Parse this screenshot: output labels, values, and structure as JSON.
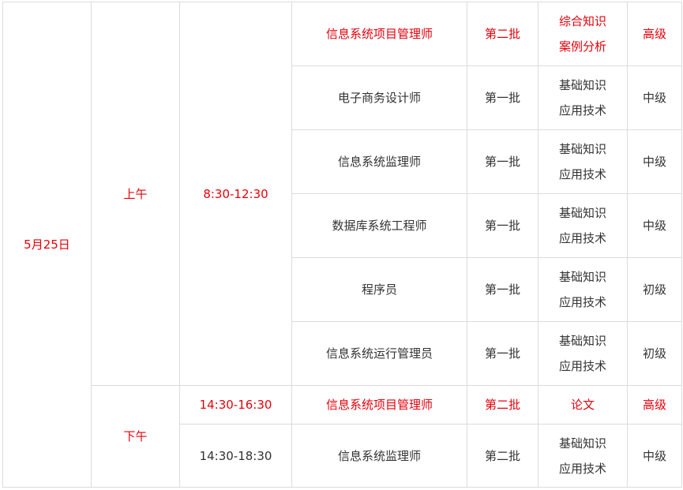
{
  "colors": {
    "highlight": "#e8000b",
    "text": "#333333",
    "border": "#dcdcdc"
  },
  "schedule": {
    "date": "5月25日",
    "morning": {
      "label": "上午",
      "time": "8:30-12:30"
    },
    "afternoon": {
      "label": "下午"
    },
    "rows": [
      {
        "time": "",
        "exam": "信息系统项目管理师",
        "batch": "第二批",
        "subjects": [
          "综合知识",
          "案例分析"
        ],
        "level": "高级",
        "highlight": true
      },
      {
        "time": "",
        "exam": "电子商务设计师",
        "batch": "第一批",
        "subjects": [
          "基础知识",
          "应用技术"
        ],
        "level": "中级",
        "highlight": false
      },
      {
        "time": "",
        "exam": "信息系统监理师",
        "batch": "第一批",
        "subjects": [
          "基础知识",
          "应用技术"
        ],
        "level": "中级",
        "highlight": false
      },
      {
        "time": "",
        "exam": "数据库系统工程师",
        "batch": "第一批",
        "subjects": [
          "基础知识",
          "应用技术"
        ],
        "level": "中级",
        "highlight": false
      },
      {
        "time": "",
        "exam": "程序员",
        "batch": "第一批",
        "subjects": [
          "基础知识",
          "应用技术"
        ],
        "level": "初级",
        "highlight": false
      },
      {
        "time": "",
        "exam": "信息系统运行管理员",
        "batch": "第一批",
        "subjects": [
          "基础知识",
          "应用技术"
        ],
        "level": "初级",
        "highlight": false
      },
      {
        "time": "14:30-16:30",
        "exam": "信息系统项目管理师",
        "batch": "第二批",
        "subjects": [
          "论文"
        ],
        "level": "高级",
        "highlight": true
      },
      {
        "time": "14:30-18:30",
        "exam": "信息系统监理师",
        "batch": "第二批",
        "subjects": [
          "基础知识",
          "应用技术"
        ],
        "level": "中级",
        "highlight": false
      }
    ]
  }
}
